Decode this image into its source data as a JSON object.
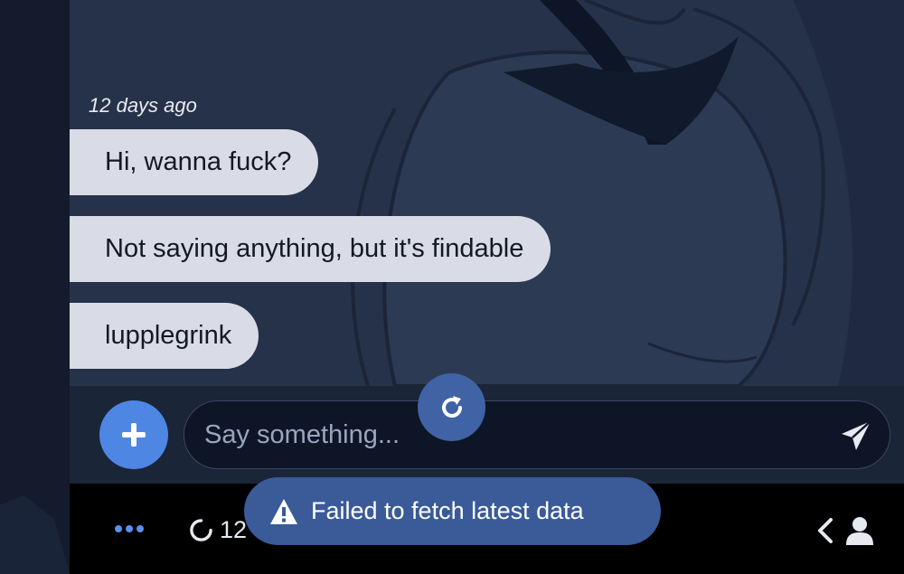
{
  "chat": {
    "timestamp": "12 days ago",
    "messages": [
      {
        "text": "Hi, wanna fuck?"
      },
      {
        "text": "Not saying anything, but it's findable"
      },
      {
        "text": "lupplegrink"
      }
    ]
  },
  "composer": {
    "placeholder": "Say something...",
    "add_icon": "plus-icon",
    "send_icon": "send-icon",
    "refresh_icon": "refresh-icon"
  },
  "bottom_bar": {
    "more_icon": "more-dots-icon",
    "loading_icon": "loading-icon",
    "count_text": "12",
    "back_icon": "chevron-left-icon",
    "user_icon": "user-icon"
  },
  "toast": {
    "message": "Failed to fetch latest data",
    "icon": "warning-icon"
  },
  "colors": {
    "accent": "#4e86e4",
    "toast_bg": "#3a5a98",
    "bubble_bg": "#d9dce6",
    "background": "#263249"
  }
}
